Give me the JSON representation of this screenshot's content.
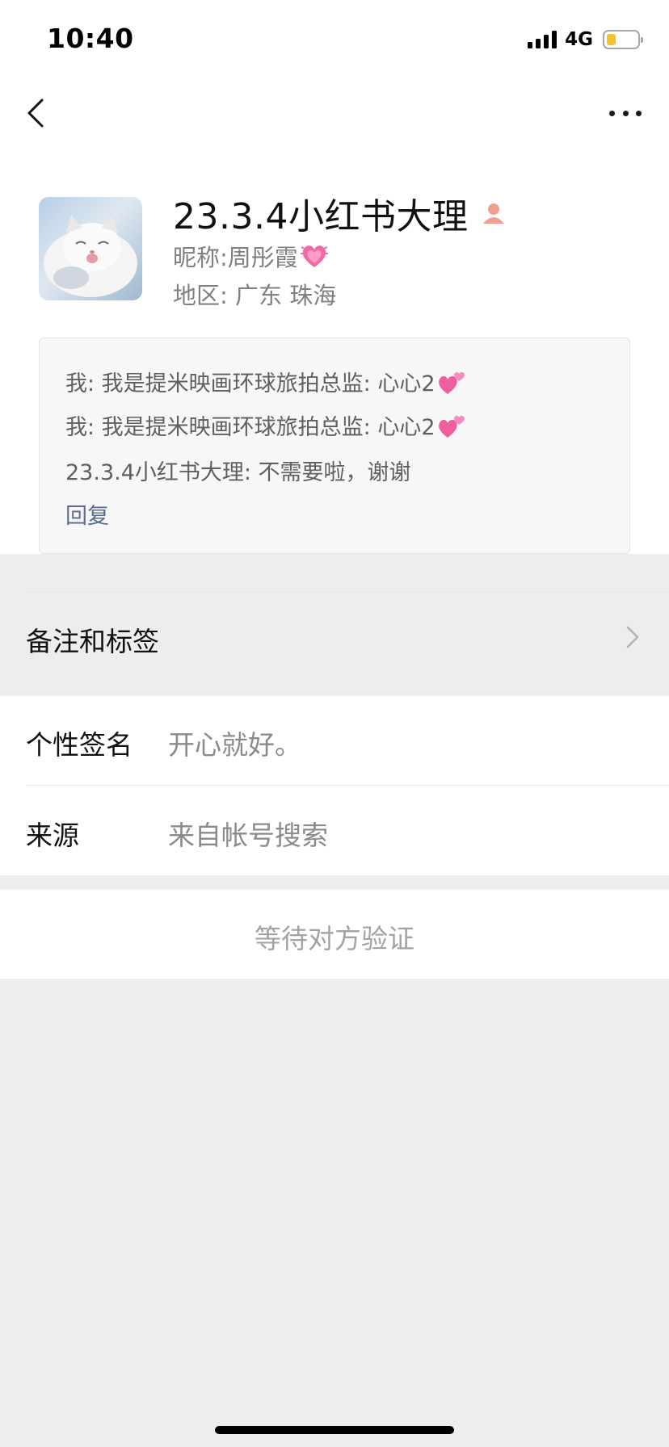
{
  "status_bar": {
    "time": "10:40",
    "network": "4G",
    "battery_percent": 30
  },
  "nav": {
    "back_icon": "chevron-left-icon",
    "more_icon": "more-dots-icon"
  },
  "profile": {
    "name": "23.3.4小红书大理",
    "nickname_label": "昵称: ",
    "nickname": "周彤霞",
    "region_label": "地区: ",
    "region": "广东 珠海"
  },
  "messages": [
    {
      "text": "我: 我是提米映画环球旅拍总监: 心心2"
    },
    {
      "text": "我: 我是提米映画环球旅拍总监: 心心2"
    },
    {
      "text": "23.3.4小红书大理: 不需要啦，谢谢"
    }
  ],
  "reply_label": "回复",
  "remarks_label": "备注和标签",
  "signature": {
    "label": "个性签名",
    "value": "开心就好。"
  },
  "source": {
    "label": "来源",
    "value": "来自帐号搜索"
  },
  "verify_label": "等待对方验证",
  "colors": {
    "link": "#576b95",
    "battery": "#f4c230",
    "background": "#ededed"
  }
}
